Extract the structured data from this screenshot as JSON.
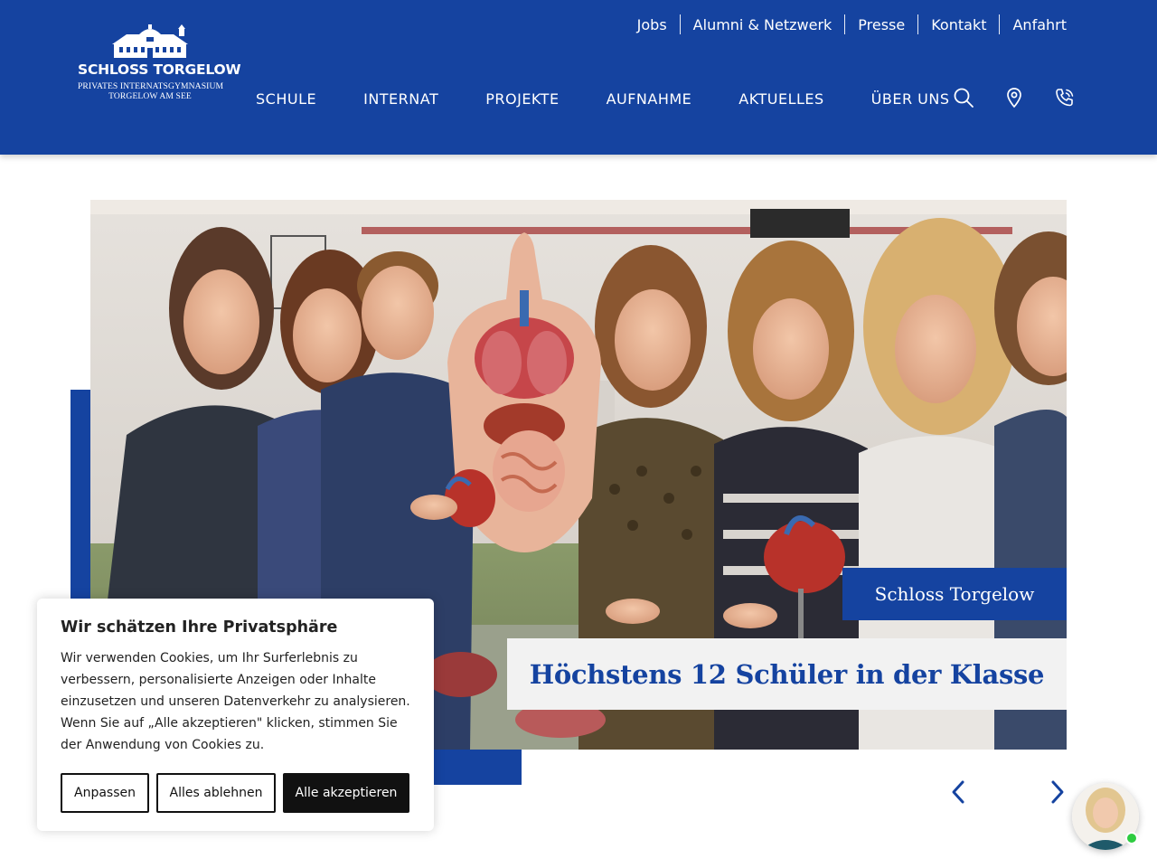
{
  "brand": {
    "name": "SCHLOSS TORGELOW",
    "subtitle_line1": "PRIVATES INTERNATSGYMNASIUM",
    "subtitle_line2": "TORGELOW AM SEE",
    "primary_color": "#1543a0"
  },
  "top_nav": {
    "items": [
      "Jobs",
      "Alumni & Netzwerk",
      "Presse",
      "Kontakt",
      "Anfahrt"
    ]
  },
  "main_nav": {
    "items": [
      "SCHULE",
      "INTERNAT",
      "PROJEKTE",
      "AUFNAHME",
      "AKTUELLES",
      "ÜBER UNS"
    ],
    "icons": [
      "search-icon",
      "location-pin-icon",
      "phone-icon"
    ]
  },
  "hero": {
    "image_alt": "Lehrerin und Schüler am anatomischen Torso-Modell",
    "caption_small": "Schloss Torgelow",
    "caption_main": "Höchstens 12 Schüler in der Klasse",
    "prev_icon": "chevron-left-icon",
    "next_icon": "chevron-right-icon"
  },
  "cookie_banner": {
    "title": "Wir schätzen Ihre Privatsphäre",
    "text": "Wir verwenden Cookies, um Ihr Surferlebnis zu verbessern, personalisierte Anzeigen oder Inhalte einzusetzen und unseren Datenverkehr zu analysieren. Wenn Sie auf „Alle akzeptieren\" klicken, stimmen Sie der Anwendung von Cookies zu.",
    "customize_label": "Anpassen",
    "reject_label": "Alles ablehnen",
    "accept_label": "Alle akzeptieren"
  },
  "chat_widget": {
    "status": "online",
    "status_color": "#2ecc40"
  }
}
